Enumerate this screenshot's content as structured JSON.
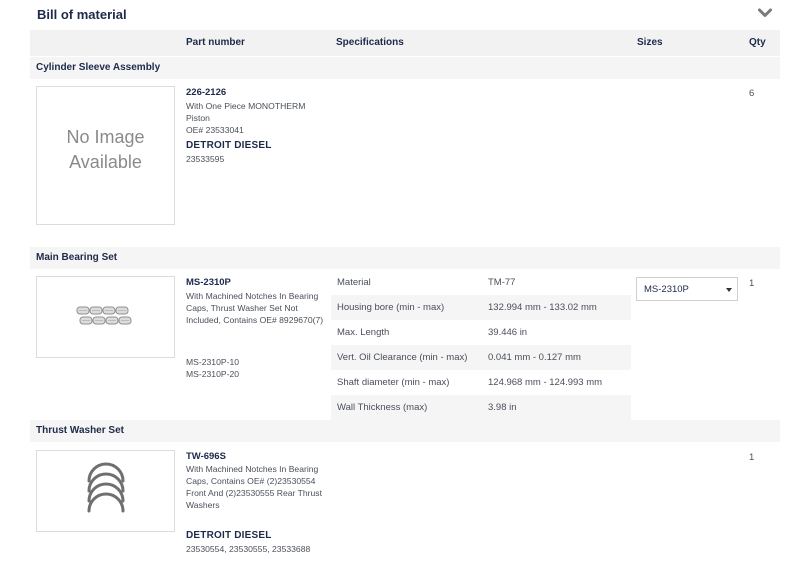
{
  "header": {
    "title": "Bill of material",
    "toggle_icon": "chevron-down-icon"
  },
  "columns": {
    "part_number": "Part number",
    "specifications": "Specifications",
    "sizes": "Sizes",
    "qty": "Qty"
  },
  "groups": [
    {
      "title": "Cylinder Sleeve Assembly",
      "image_placeholder": [
        "No Image",
        "Available"
      ],
      "part_number": "226-2126",
      "description": [
        "With One Piece MONOTHERM Piston",
        "OE# 23533041"
      ],
      "brand": "DETROIT DIESEL",
      "brand_numbers": "23533595",
      "qty": "6"
    },
    {
      "title": "Main Bearing Set",
      "image_icon": "bearing-set-icon",
      "part_number": "MS-2310P",
      "description": [
        "With Machined Notches In Bearing",
        "Caps, Thrust Washer Set Not",
        "Included, Contains OE# 8929670(7)"
      ],
      "variants": [
        "MS-2310P-10",
        "MS-2310P-20"
      ],
      "specs": [
        {
          "key": "Material",
          "value": "TM-77"
        },
        {
          "key": "Housing bore (min - max)",
          "value": "132.994 mm - 133.02 mm"
        },
        {
          "key": "Max. Length",
          "value": "39.446 in"
        },
        {
          "key": "Vert. Oil Clearance (min - max)",
          "value": "0.041 mm - 0.127 mm"
        },
        {
          "key": "Shaft diameter (min - max)",
          "value": "124.968 mm - 124.993 mm"
        },
        {
          "key": "Wall Thickness (max)",
          "value": "3.98 in"
        }
      ],
      "size_selected": "MS-2310P",
      "qty": "1"
    },
    {
      "title": "Thrust Washer Set",
      "image_icon": "thrust-washer-icon",
      "part_number": "TW-696S",
      "description": [
        "With Machined Notches In Bearing",
        "Caps, Contains OE# (2)23530554",
        "Front And (2)23530555 Rear Thrust",
        "Washers"
      ],
      "brand": "DETROIT DIESEL",
      "brand_numbers": "23530554, 23530555, 23533688",
      "qty": "1"
    }
  ]
}
